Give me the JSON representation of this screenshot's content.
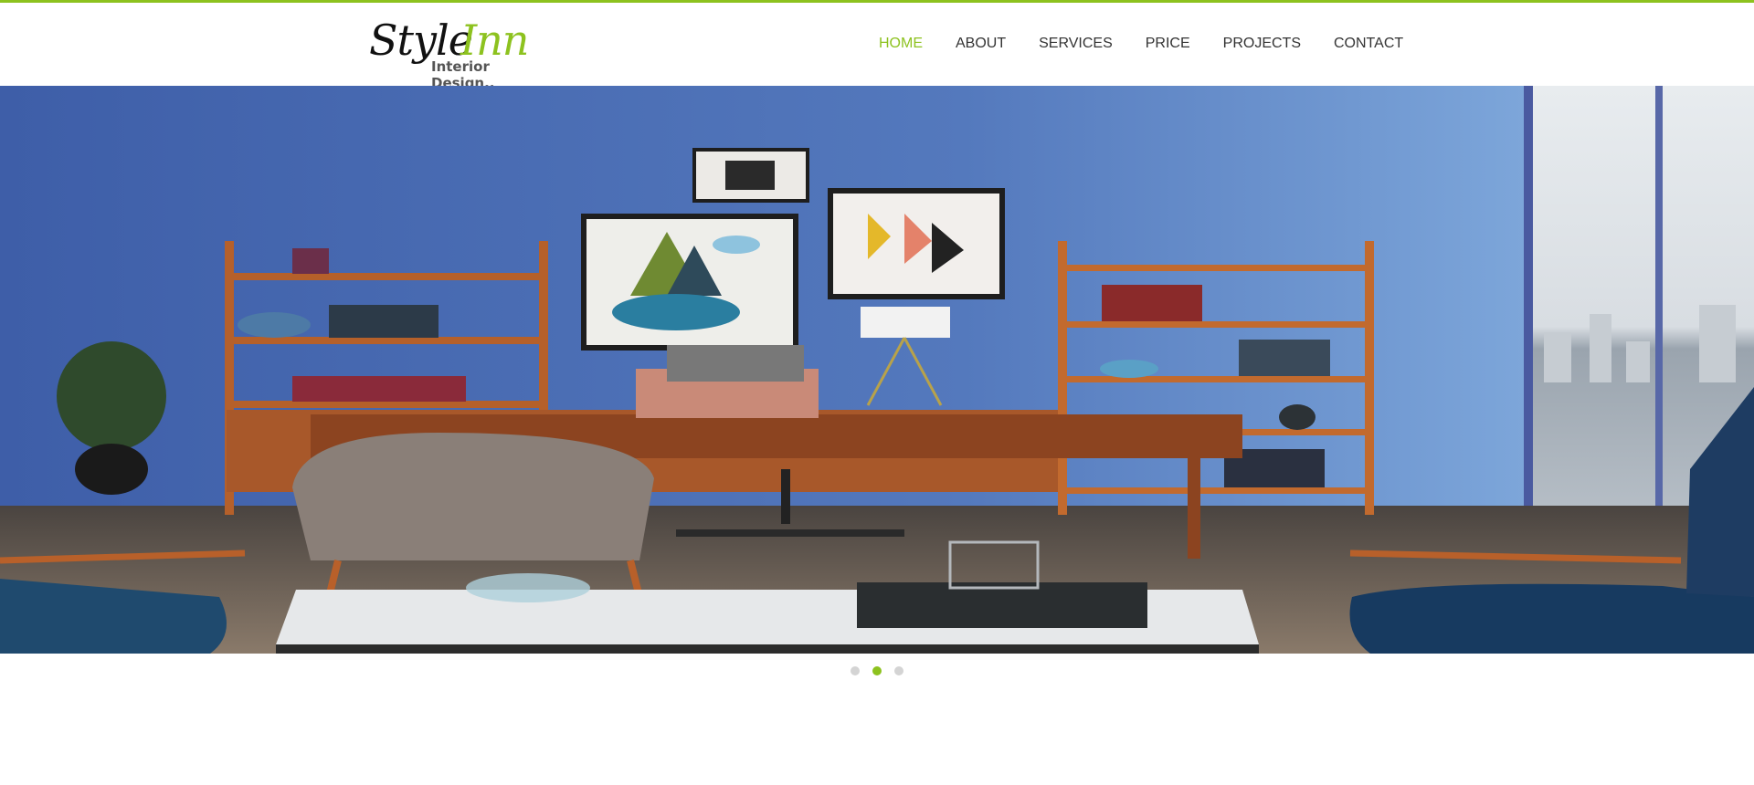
{
  "brand": {
    "logo_word1": "Style",
    "logo_word2": "Inn",
    "tagline": "Interior Design..",
    "accent_color": "#8dc21f"
  },
  "nav": {
    "items": [
      {
        "label": "HOME",
        "active": true
      },
      {
        "label": "ABOUT",
        "active": false
      },
      {
        "label": "SERVICES",
        "active": false
      },
      {
        "label": "PRICE",
        "active": false
      },
      {
        "label": "PROJECTS",
        "active": false
      },
      {
        "label": "CONTACT",
        "active": false
      }
    ]
  },
  "hero": {
    "image": "interior-office-photo"
  },
  "slider": {
    "dot_count": 3,
    "active_index": 1
  }
}
